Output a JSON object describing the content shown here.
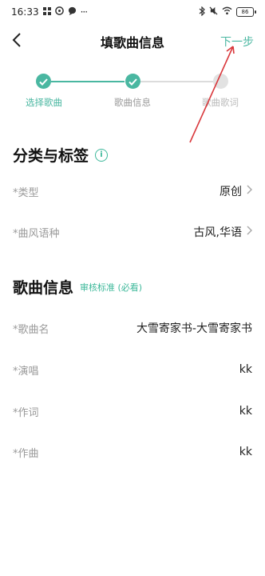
{
  "status_bar": {
    "time": "16:33",
    "left_icons": [
      "grid-icon",
      "pinwheel-icon",
      "chat-bubble-icon",
      "more-dots-icon"
    ],
    "right_icons": [
      "bluetooth-icon",
      "mute-icon",
      "wifi-icon"
    ],
    "battery": "86"
  },
  "header": {
    "title": "填歌曲信息",
    "next_label": "下一步"
  },
  "steps": [
    {
      "label": "选择歌曲",
      "state": "done"
    },
    {
      "label": "歌曲信息",
      "state": "done"
    },
    {
      "label": "歌曲歌词",
      "state": "pending"
    }
  ],
  "section_category": {
    "title": "分类与标签",
    "rows": [
      {
        "label": "*类型",
        "value": "原创"
      },
      {
        "label": "*曲风语种",
        "value": "古风,华语"
      }
    ]
  },
  "section_song": {
    "title": "歌曲信息",
    "review_link": "审核标准 (必看)",
    "rows": [
      {
        "label": "*歌曲名",
        "value": "大雪寄家书-大雪寄家书"
      },
      {
        "label": "*演唱",
        "value": "kk"
      },
      {
        "label": "*作词",
        "value": "kk"
      },
      {
        "label": "*作曲",
        "value": "kk"
      }
    ]
  },
  "colors": {
    "accent": "#4ab7a1",
    "annotation": "#d9383c"
  }
}
